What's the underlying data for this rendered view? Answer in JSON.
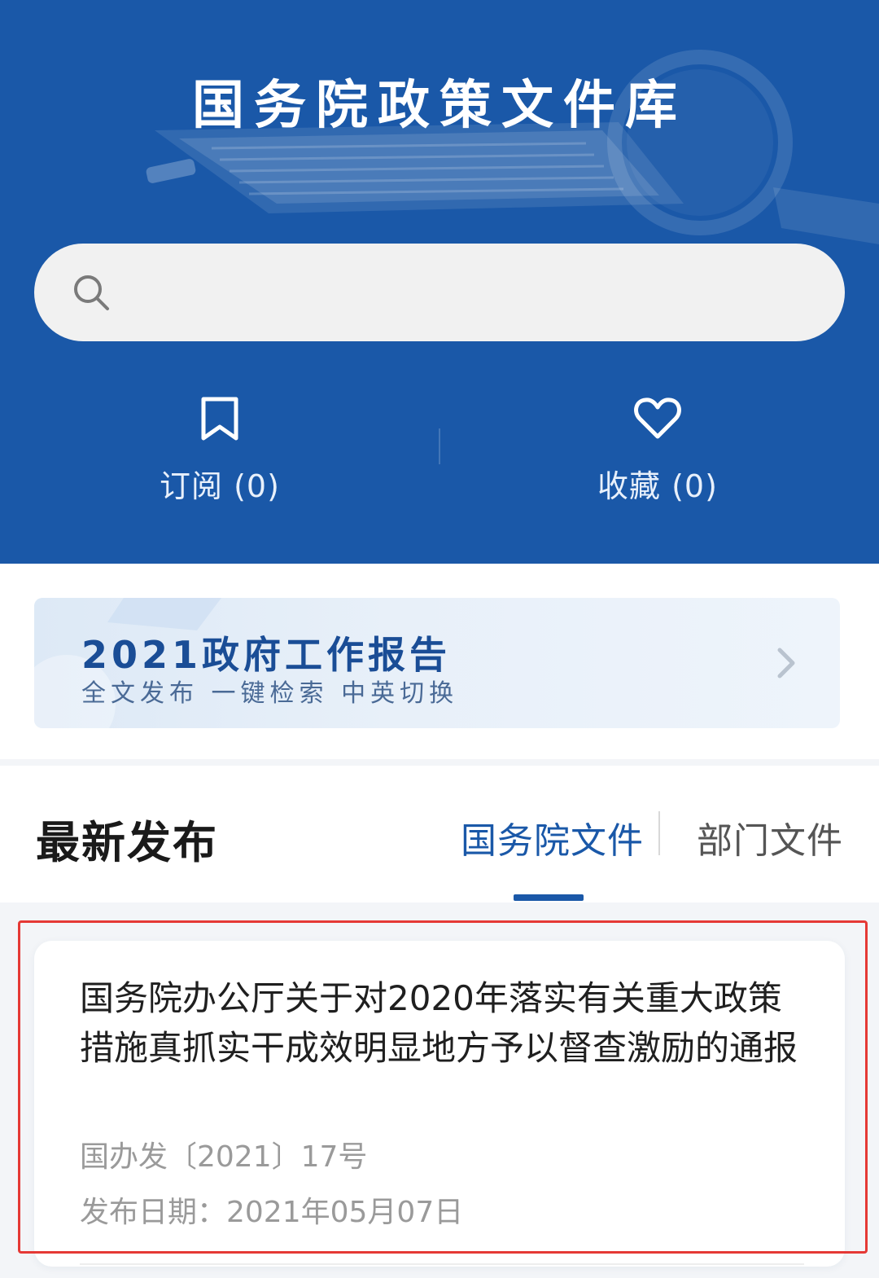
{
  "header": {
    "title": "国务院政策文件库",
    "bg_color": "#1a58a8"
  },
  "search": {
    "placeholder": "",
    "value": "",
    "icon": "search-icon"
  },
  "quick_actions": [
    {
      "label": "订阅 (0)",
      "icon": "bookmark-icon"
    },
    {
      "label": "收藏 (0)",
      "icon": "heart-icon"
    }
  ],
  "banner": {
    "title": "2021政府工作报告",
    "subtitle": "全文发布 一键检索 中英切换",
    "icon": "chevron-right-icon"
  },
  "latest": {
    "title": "最新发布",
    "tabs": [
      {
        "label": "国务院文件",
        "active": true
      },
      {
        "label": "部门文件",
        "active": false
      }
    ],
    "accent_color": "#1a58a8"
  },
  "documents": [
    {
      "title": "国务院办公厅关于对2020年落实有关重大政策措施真抓实干成效明显地方予以督查激励的通报",
      "doc_number": "国办发〔2021〕17号",
      "publish_date": "发布日期：2021年05月07日"
    }
  ],
  "highlight_color": "#e53935"
}
